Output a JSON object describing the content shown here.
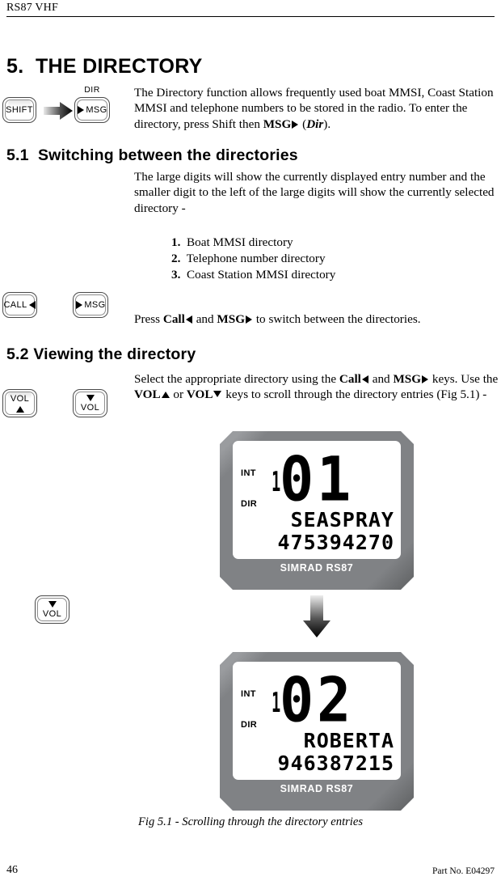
{
  "header": {
    "title": "RS87 VHF"
  },
  "sections": {
    "s5": {
      "heading": "5.  THE DIRECTORY",
      "paragraph_a": "The Directory function allows frequently used boat MMSI, Coast Station MMSI and telephone numbers to be stored in the radio.  To enter the directory, press Shift then ",
      "paragraph_a_bold": "MSG",
      "paragraph_a_tail": " (",
      "paragraph_a_italic": "Dir",
      "paragraph_a_end": ").",
      "keys": {
        "shift_label": "SHIFT",
        "msg_label": "MSG",
        "msg_cap_label": "DIR"
      }
    },
    "s51": {
      "heading": "5.1  Switching between the directories",
      "paragraph": "The large digits will show the currently displayed entry number and the smaller digit to the left of the large digits will show the currently selected directory -",
      "list": [
        {
          "num": "1.",
          "text": "Boat MMSI directory"
        },
        {
          "num": "2.",
          "text": "Telephone number directory"
        },
        {
          "num": "3.",
          "text": "Coast Station MMSI directory"
        }
      ],
      "instruction_pre": "Press ",
      "instruction_b1": "Call",
      "instruction_mid": " and ",
      "instruction_b2": "MSG",
      "instruction_post": " to switch between the directories.",
      "keys": {
        "call_label": "CALL",
        "msg_label": "MSG"
      }
    },
    "s52": {
      "heading": "5.2 Viewing the directory",
      "instruction_pre": "Select the appropriate directory using the ",
      "instruction_b1": "Call",
      "instruction_mid1": " and ",
      "instruction_b2": "MSG",
      "instruction_mid2": " keys.  Use the ",
      "instruction_b3": "VOL",
      "instruction_mid3": " or ",
      "instruction_b4": "VOL",
      "instruction_post": " keys to scroll through the directory entries (Fig 5.1) -",
      "keys": {
        "vol_up_label": "VOL",
        "vol_down_label": "VOL",
        "vol_down2_label": "VOL"
      }
    }
  },
  "figure": {
    "caption": "Fig 5.1 - Scrolling through the directory entries",
    "displays": [
      {
        "annotation_int": "INT",
        "annotation_dir": "DIR",
        "small_digit": "1",
        "big_digits": "01",
        "name": "SEASPRAY",
        "number": "475394270",
        "brand": "SIMRAD RS87"
      },
      {
        "annotation_int": "INT",
        "annotation_dir": "DIR",
        "small_digit": "1",
        "big_digits": "02",
        "name": "ROBERTA",
        "number": "946387215",
        "brand": "SIMRAD RS87"
      }
    ]
  },
  "footer": {
    "page_number": "46",
    "part_number": "Part No. E04297"
  },
  "colors": {
    "bezel_gray": "#808285",
    "bezel_dark": "#1c1c1c",
    "lcd_white": "#ffffff",
    "ink": "#000000"
  }
}
